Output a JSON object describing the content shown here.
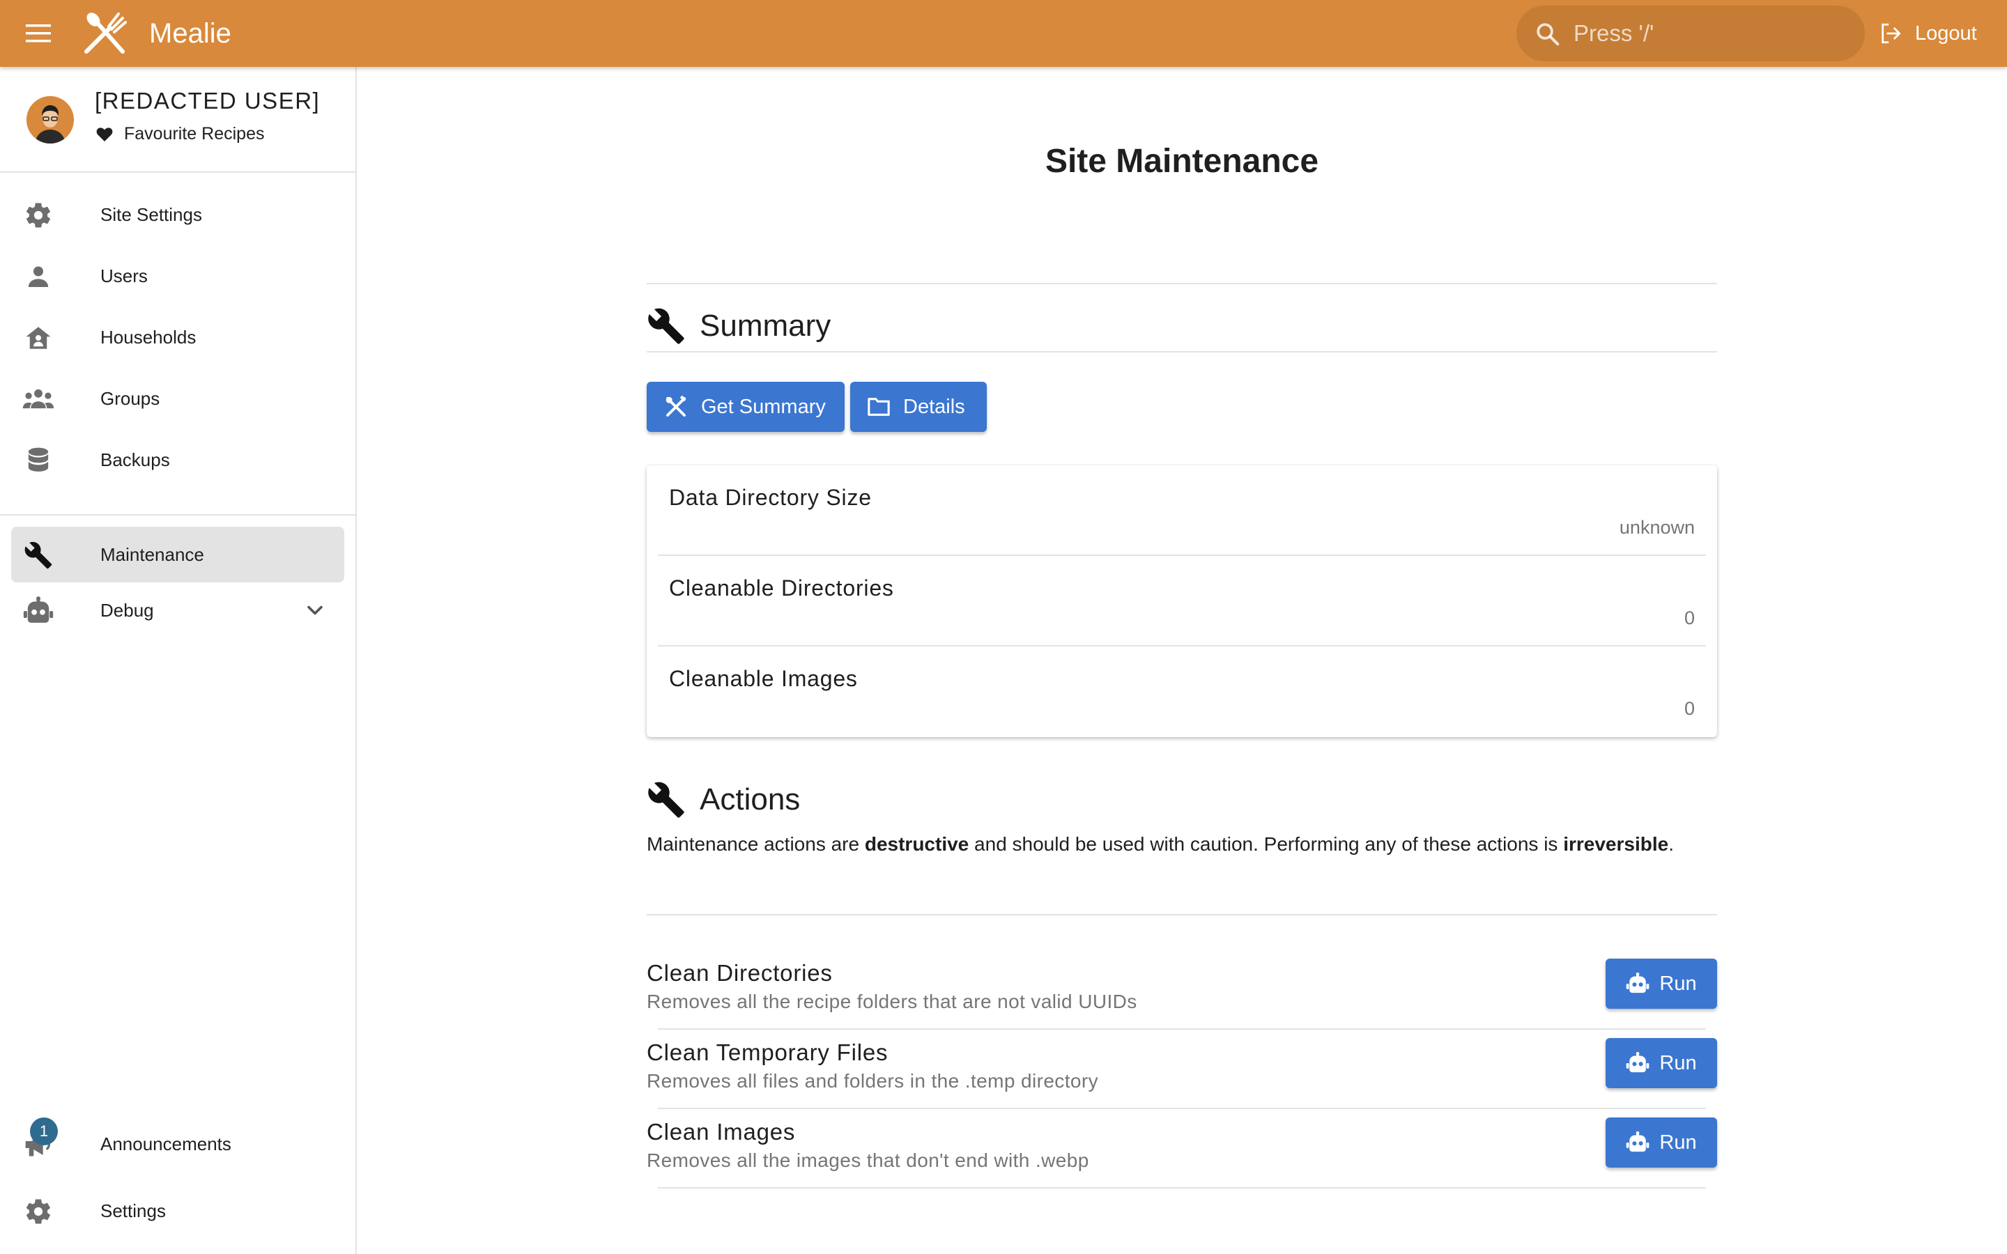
{
  "header": {
    "app_title": "Mealie",
    "search_placeholder": "Press '/'",
    "logout_label": "Logout",
    "color": "#d9893b"
  },
  "sidebar": {
    "user_name": "[REDACTED USER]",
    "favourites_label": "Favourite Recipes",
    "items": [
      {
        "label": "Site Settings",
        "icon": "gear-icon"
      },
      {
        "label": "Users",
        "icon": "user-icon"
      },
      {
        "label": "Households",
        "icon": "household-icon"
      },
      {
        "label": "Groups",
        "icon": "groups-icon"
      },
      {
        "label": "Backups",
        "icon": "database-icon"
      },
      {
        "label": "Maintenance",
        "icon": "wrench-icon",
        "active": true
      },
      {
        "label": "Debug",
        "icon": "robot-icon"
      }
    ],
    "bottom": [
      {
        "label": "Announcements",
        "icon": "megaphone-icon",
        "badge": "1"
      },
      {
        "label": "Settings",
        "icon": "gear-icon"
      }
    ]
  },
  "main": {
    "page_title": "Site Maintenance",
    "summary": {
      "title": "Summary",
      "get_summary_label": "Get Summary",
      "details_label": "Details",
      "rows": [
        {
          "label": "Data Directory Size",
          "value": "unknown"
        },
        {
          "label": "Cleanable Directories",
          "value": "0"
        },
        {
          "label": "Cleanable Images",
          "value": "0"
        }
      ]
    },
    "actions": {
      "title": "Actions",
      "caution_pre": "Maintenance actions are ",
      "caution_bold1": "destructive",
      "caution_mid": " and should be used with caution. Performing any of these actions is ",
      "caution_bold2": "irreversible",
      "caution_end": ".",
      "items": [
        {
          "title": "Clean Directories",
          "description": "Removes all the recipe folders that are not valid UUIDs",
          "button": "Run"
        },
        {
          "title": "Clean Temporary Files",
          "description": "Removes all files and folders in the .temp directory",
          "button": "Run"
        },
        {
          "title": "Clean Images",
          "description": "Removes all the images that don't end with .webp",
          "button": "Run"
        }
      ]
    },
    "accent_color": "#3b76d1"
  }
}
